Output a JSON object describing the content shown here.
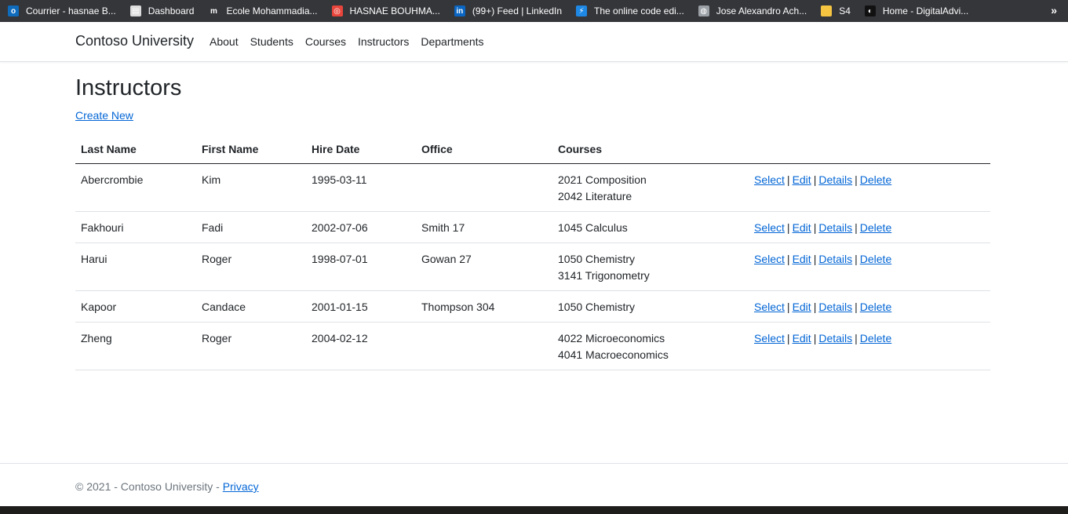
{
  "bookmarks": [
    {
      "label": "Courrier - hasnae B...",
      "icon": "outlook-icon",
      "color": "#0f6cbd"
    },
    {
      "label": "Dashboard",
      "icon": "dashboard-icon",
      "color": "#dddddd"
    },
    {
      "label": "Ecole Mohammadia...",
      "icon": "moodle-icon",
      "color": "#35363a"
    },
    {
      "label": "HASNAE BOUHMA...",
      "icon": "swirl-icon",
      "color": "#e8453c"
    },
    {
      "label": "(99+) Feed | LinkedIn",
      "icon": "linkedin-icon",
      "color": "#0a66c2"
    },
    {
      "label": "The online code edi...",
      "icon": "lightning-icon",
      "color": "#1e88e5"
    },
    {
      "label": "Jose Alexandro Ach...",
      "icon": "globe-icon",
      "color": "#9aa0a6"
    },
    {
      "label": "S4",
      "icon": "folder-icon",
      "color": "#f5c542"
    },
    {
      "label": "Home - DigitalAdvi...",
      "icon": "digitaladvisor-icon",
      "color": "#111111"
    }
  ],
  "bookmarks_more": "»",
  "navbar": {
    "brand": "Contoso University",
    "links": [
      "About",
      "Students",
      "Courses",
      "Instructors",
      "Departments"
    ]
  },
  "page": {
    "title": "Instructors",
    "create_new": "Create New"
  },
  "table": {
    "headers": [
      "Last Name",
      "First Name",
      "Hire Date",
      "Office",
      "Courses"
    ],
    "rows": [
      {
        "last": "Abercrombie",
        "first": "Kim",
        "hire": "1995-03-11",
        "office": "",
        "courses": [
          "2021 Composition",
          "2042 Literature"
        ]
      },
      {
        "last": "Fakhouri",
        "first": "Fadi",
        "hire": "2002-07-06",
        "office": "Smith 17",
        "courses": [
          "1045 Calculus"
        ]
      },
      {
        "last": "Harui",
        "first": "Roger",
        "hire": "1998-07-01",
        "office": "Gowan 27",
        "courses": [
          "1050 Chemistry",
          "3141 Trigonometry"
        ]
      },
      {
        "last": "Kapoor",
        "first": "Candace",
        "hire": "2001-01-15",
        "office": "Thompson 304",
        "courses": [
          "1050 Chemistry"
        ]
      },
      {
        "last": "Zheng",
        "first": "Roger",
        "hire": "2004-02-12",
        "office": "",
        "courses": [
          "4022 Microeconomics",
          "4041 Macroeconomics"
        ]
      }
    ],
    "actions": [
      "Select",
      "Edit",
      "Details",
      "Delete"
    ],
    "separator": "|"
  },
  "footer": {
    "copyright": "© 2021 - Contoso University - ",
    "privacy": "Privacy"
  }
}
